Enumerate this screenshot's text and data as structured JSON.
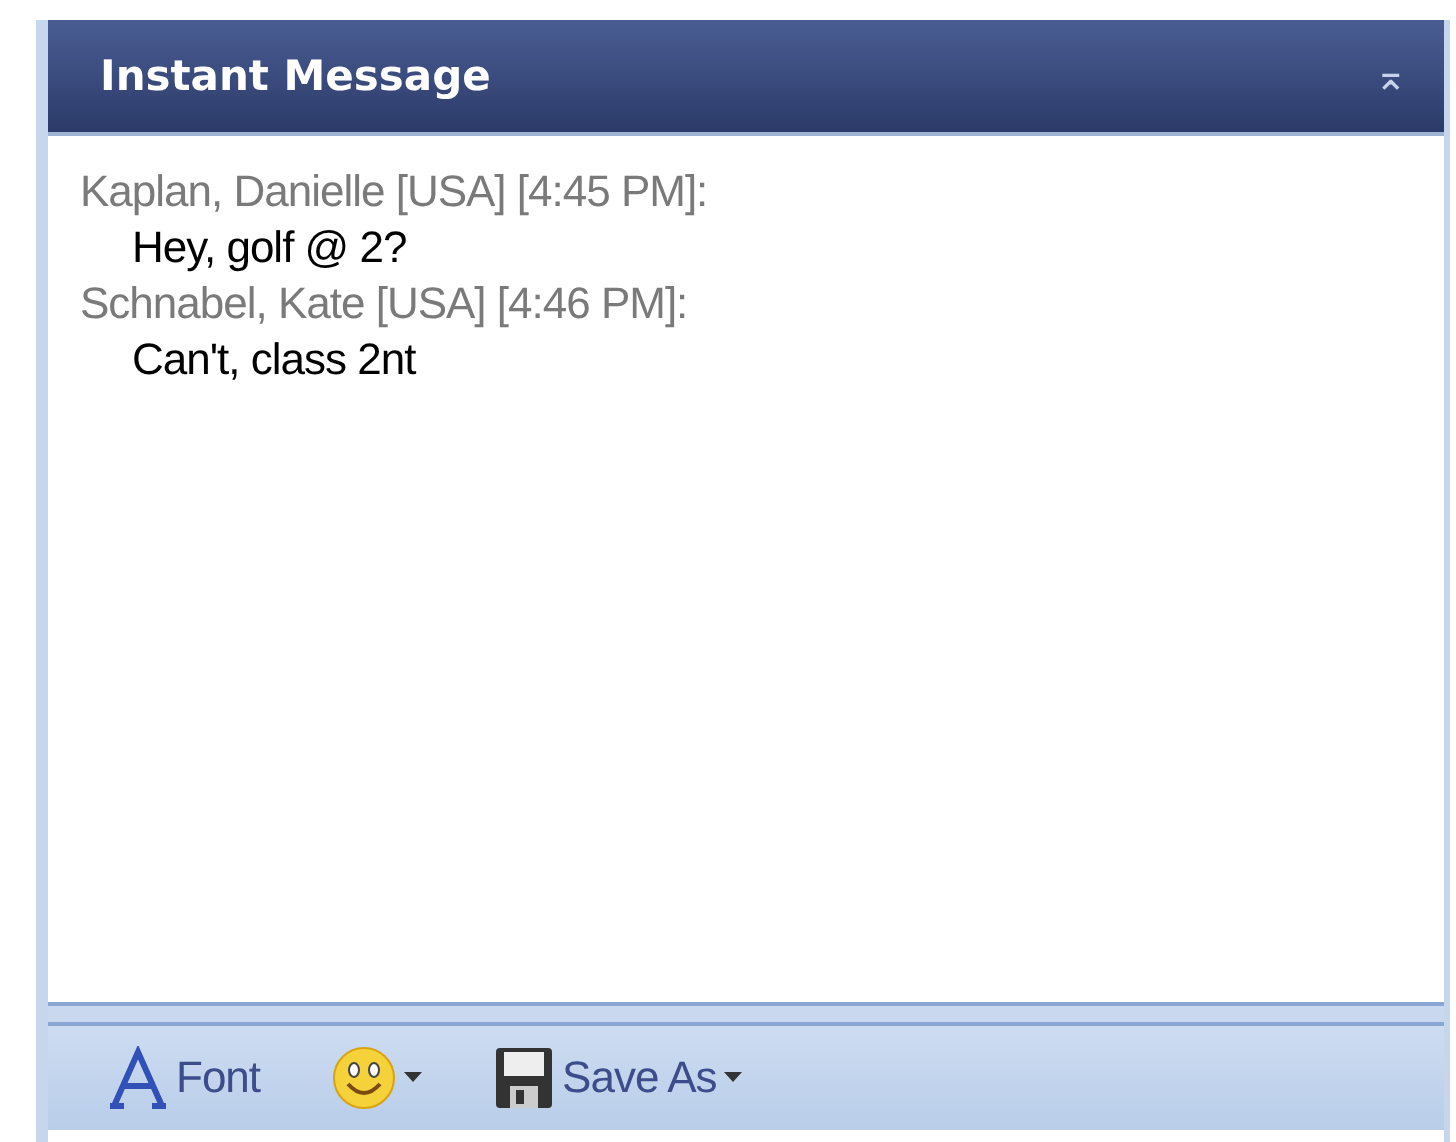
{
  "panel": {
    "title": "Instant Message",
    "collapse_glyph": "⌅"
  },
  "messages": [
    {
      "header": "Kaplan, Danielle [USA] [4:45 PM]:",
      "text": "Hey, golf @ 2?"
    },
    {
      "header": "Schnabel, Kate [USA] [4:46 PM]:",
      "text": "Can't, class 2nt"
    }
  ],
  "toolbar": [
    {
      "kind": "font",
      "label": "Font"
    },
    {
      "kind": "emoticon"
    },
    {
      "kind": "save",
      "label": "Save As"
    }
  ]
}
